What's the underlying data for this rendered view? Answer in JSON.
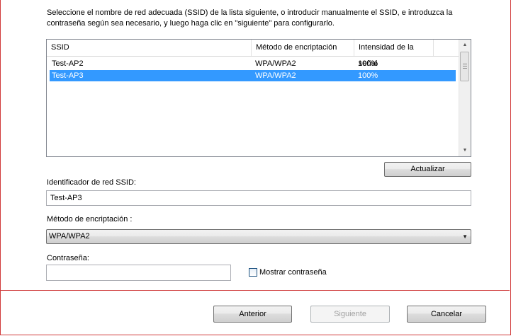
{
  "instructions": {
    "line1": "Seleccione el nombre de red adecuada (SSID) de la lista siguiente, o introducir manualmente el SSID, e introduzca la",
    "line2": "contraseña según sea necesario, y luego haga clic en \"siguiente\" para configurarlo."
  },
  "network_list": {
    "columns": [
      "SSID",
      "Método de encriptación",
      "Intensidad de la señal"
    ],
    "rows": [
      {
        "ssid": "Test-AP2",
        "encryption": "WPA/WPA2",
        "signal": "100%",
        "selected": false
      },
      {
        "ssid": "Test-AP3",
        "encryption": "WPA/WPA2",
        "signal": "100%",
        "selected": true
      }
    ]
  },
  "refresh_button": "Actualizar",
  "ssid_field": {
    "label": "Identificador de red SSID:",
    "value": "Test-AP3"
  },
  "encryption_field": {
    "label": "Método de encriptación :",
    "value": "WPA/WPA2"
  },
  "password_field": {
    "label": "Contraseña:",
    "value": ""
  },
  "show_password": {
    "label": "Mostrar contraseña",
    "checked": false
  },
  "footer": {
    "back": "Anterior",
    "next": "Siguiente",
    "cancel": "Cancelar"
  },
  "colors": {
    "accent_border": "#d03a3a",
    "selection": "#3399ff"
  },
  "icons": {
    "scroll_up": "triangle-up-icon",
    "scroll_down": "triangle-down-icon",
    "combo_arrow": "triangle-down-icon"
  }
}
